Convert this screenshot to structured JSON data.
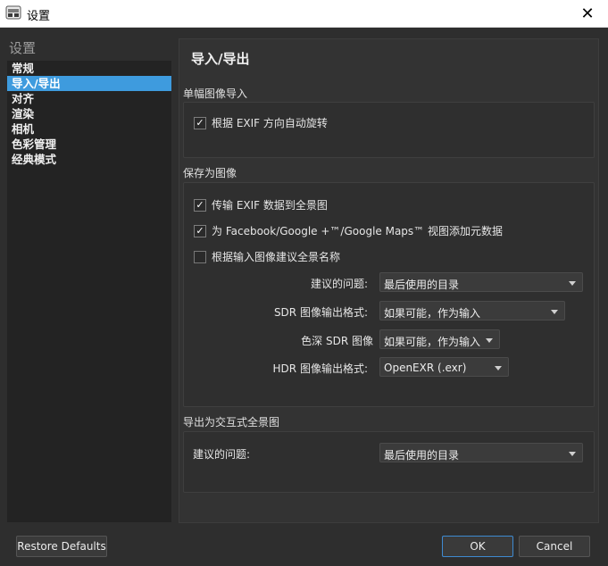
{
  "window": {
    "title": "设置",
    "close_glyph": "✕",
    "app_icon": "pano-app-icon"
  },
  "sidebar": {
    "heading": "设置",
    "items": [
      {
        "label": "常规",
        "active": false
      },
      {
        "label": "导入/导出",
        "active": true
      },
      {
        "label": "对齐",
        "active": false
      },
      {
        "label": "渲染",
        "active": false
      },
      {
        "label": "相机",
        "active": false
      },
      {
        "label": "色彩管理",
        "active": false
      },
      {
        "label": "经典模式",
        "active": false
      }
    ]
  },
  "main": {
    "title": "导入/导出",
    "single_import": {
      "label": "单幅图像导入",
      "auto_rotate": {
        "label": "根据 EXIF 方向自动旋转",
        "checked": true
      }
    },
    "save_as_image": {
      "label": "保存为图像",
      "transfer_exif": {
        "label": "传输 EXIF 数据到全景图",
        "checked": true
      },
      "add_metadata": {
        "label": "为 Facebook/Google +™/Google Maps™ 视图添加元数据",
        "checked": true
      },
      "suggest_name": {
        "label": "根据输入图像建议全景名称",
        "checked": false
      },
      "suggested_location": {
        "label": "建议的问题:",
        "value": "最后使用的目录"
      },
      "sdr_format": {
        "label": "SDR 图像输出格式:",
        "value": "如果可能，作为输入"
      },
      "sdr_depth": {
        "label": "色深 SDR 图像",
        "value": "如果可能，作为输入"
      },
      "hdr_format": {
        "label": "HDR 图像输出格式:",
        "value": "OpenEXR (.exr)"
      }
    },
    "export_interactive": {
      "label": "导出为交互式全景图",
      "suggested_location": {
        "label": "建议的问题:",
        "value": "最后使用的目录"
      }
    }
  },
  "footer": {
    "restore_defaults": "Restore Defaults",
    "ok": "OK",
    "cancel": "Cancel"
  },
  "colors": {
    "background": "#2e2e2e",
    "sidebar_bg": "#232323",
    "selection": "#3e9bde",
    "ok_border": "#3e8ad1"
  }
}
